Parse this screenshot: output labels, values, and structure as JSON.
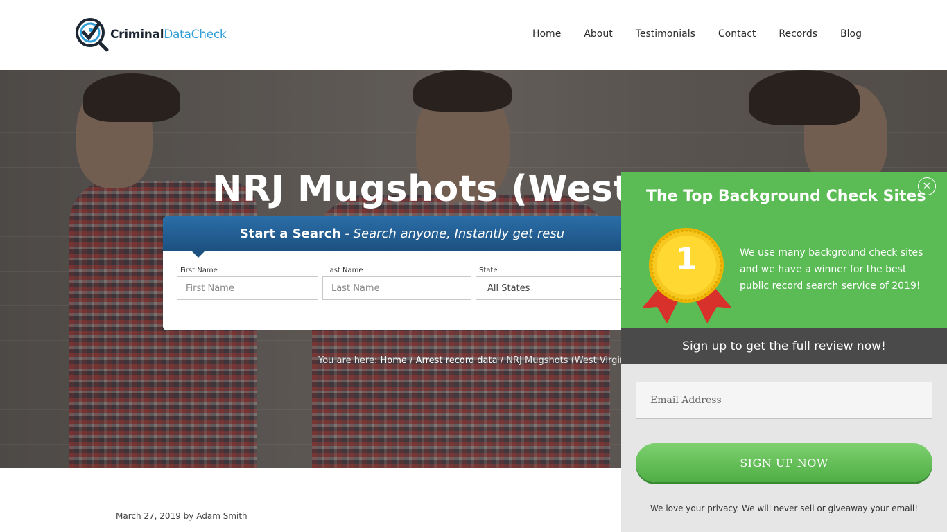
{
  "brand": {
    "logo_primary": "Criminal",
    "logo_secondary": "DataCheck",
    "colors": {
      "dark": "#1d2733",
      "blue": "#2f9ed8"
    }
  },
  "nav": {
    "items": [
      {
        "label": "Home"
      },
      {
        "label": "About"
      },
      {
        "label": "Testimonials"
      },
      {
        "label": "Contact"
      },
      {
        "label": "Records"
      },
      {
        "label": "Blog"
      }
    ]
  },
  "hero": {
    "title": "NRJ Mugshots (West Vi"
  },
  "search": {
    "heading_strong": "Start a Search",
    "heading_em": "- Search anyone, Instantly get resu",
    "first_name_label": "First Name",
    "first_name_placeholder": "First Name",
    "last_name_label": "Last Name",
    "last_name_placeholder": "Last Name",
    "state_label": "State",
    "state_value": "All States",
    "chevron_icon": "chevron-down-icon"
  },
  "breadcrumb": {
    "prefix": "You are here:",
    "home": "Home",
    "sep1": "/",
    "section": "Arrest record data",
    "sep2": "/",
    "current": "NRJ Mugshots (West Virgini"
  },
  "post": {
    "date": "March 27, 2019",
    "by": "by",
    "author": "Adam Smith"
  },
  "popup": {
    "title": "The Top Background Check Sites",
    "close_icon": "close-icon",
    "medal_number": "1",
    "description": "We use many background check sites and we have a winner for the best public record search service of 2019!",
    "band_text": "Sign up to get the full review now!",
    "email_placeholder": "Email Address",
    "signup_label": "SIGN UP NOW",
    "privacy_text": "We love your privacy.  We will never sell or giveaway your email!",
    "colors": {
      "green": "#5bbc55",
      "band": "#4a4a4a"
    }
  }
}
